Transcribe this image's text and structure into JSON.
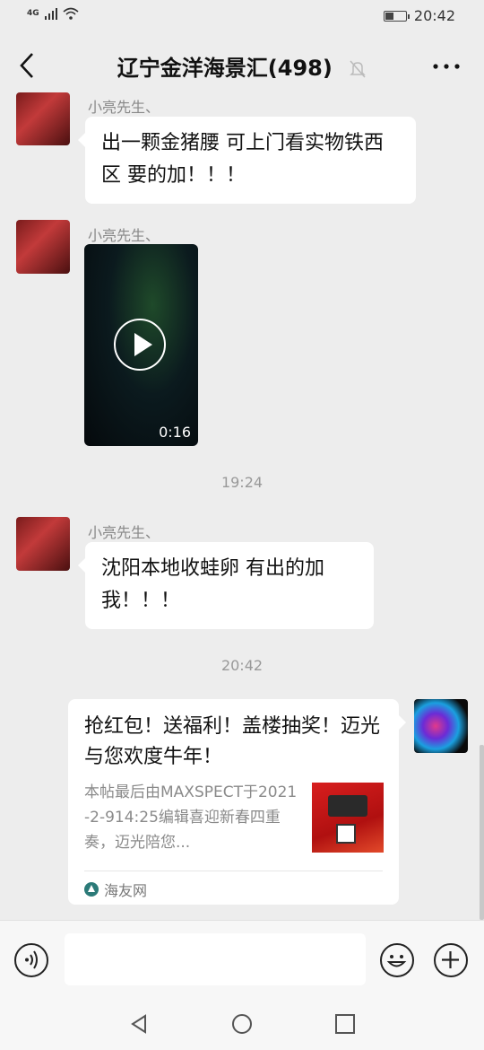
{
  "status_bar": {
    "network": "4G",
    "time": "20:42"
  },
  "header": {
    "title": "辽宁金洋海景汇(498)"
  },
  "messages": [
    {
      "sender": "小亮先生、",
      "text": "出一颗金猪腰 可上门看实物铁西区 要的加！！！"
    },
    {
      "sender": "小亮先生、",
      "video_duration": "0:16"
    },
    {
      "timestamp": "19:24"
    },
    {
      "sender": "小亮先生、",
      "text": "沈阳本地收蛙卵 有出的加我！！！"
    },
    {
      "timestamp": "20:42"
    },
    {
      "link_card": {
        "title": "抢红包！送福利！盖楼抽奖！迈光与您欢度牛年！",
        "description": "本帖最后由MAXSPECT于2021-2-914:25编辑喜迎新春四重奏，迈光陪您...",
        "source": "海友网"
      }
    }
  ],
  "input": {
    "placeholder": ""
  }
}
